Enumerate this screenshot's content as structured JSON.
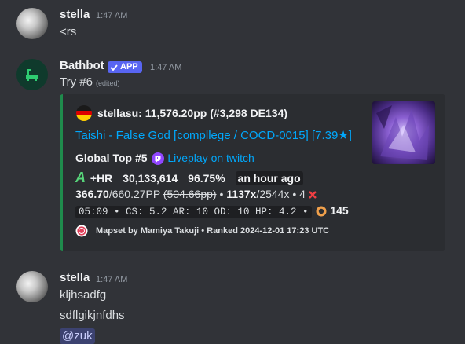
{
  "messages": [
    {
      "username": "stella",
      "time": "1:47 AM",
      "lines": [
        "<rs"
      ]
    },
    {
      "username": "Bathbot",
      "badge": "APP",
      "time": "1:47 AM",
      "text": "Try #6",
      "edited": "(edited)"
    },
    {
      "username": "stella",
      "time": "1:47 AM",
      "lines": [
        "kljhsadfg",
        "sdflgikjnfdhs"
      ],
      "mention": "@zuk"
    }
  ],
  "embed": {
    "author": "stellasu: 11,576.20pp (#3,298 DE134)",
    "title": "Taishi - False God [compllege / COCD-0015] [7.39★]",
    "global_top": "Global Top #5",
    "liveplay": "Liveplay on twitch",
    "grade": "A",
    "mods": "+HR",
    "score": "30,133,614",
    "accuracy": "96.75%",
    "when": "an hour ago",
    "pp": "366.70",
    "pp_max": "/660.27PP",
    "pp_fc": "(504.66pp)",
    "combo": "1137x",
    "combo_max": "/2544x",
    "misses": "• 4",
    "map_stats": "05:09 • CS: 5.2 AR: 10 OD: 10 HP: 4.2 •",
    "bpm": "145",
    "footer": "Mapset by Mamiya Takuji • Ranked 2024-12-01 17:23 UTC",
    "accent_color": "#1f8b4c"
  },
  "colors": {
    "background": "#313338",
    "embed_bg": "#2b2d31",
    "link": "#00a8fc",
    "app_badge": "#5865f2"
  }
}
